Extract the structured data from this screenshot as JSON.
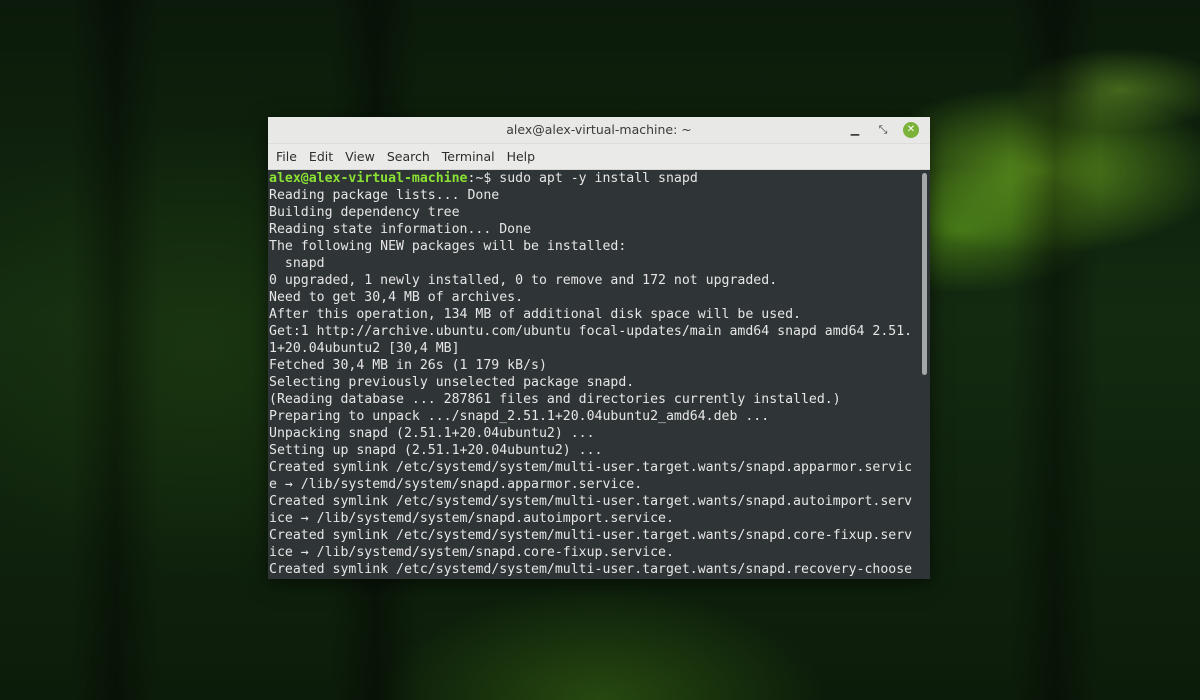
{
  "window": {
    "title": "alex@alex-virtual-machine: ~",
    "controls": {
      "minimize": "minimize-icon",
      "maximize": "restore-icon",
      "close": "close-icon"
    }
  },
  "menu": {
    "items": [
      "File",
      "Edit",
      "View",
      "Search",
      "Terminal",
      "Help"
    ]
  },
  "terminal": {
    "prompt_user": "alex@alex-virtual-machine",
    "prompt_sep": ":~$ ",
    "command": "sudo apt -y install snapd",
    "output": [
      "Reading package lists... Done",
      "Building dependency tree",
      "Reading state information... Done",
      "The following NEW packages will be installed:",
      "  snapd",
      "0 upgraded, 1 newly installed, 0 to remove and 172 not upgraded.",
      "Need to get 30,4 MB of archives.",
      "After this operation, 134 MB of additional disk space will be used.",
      "Get:1 http://archive.ubuntu.com/ubuntu focal-updates/main amd64 snapd amd64 2.51.",
      "1+20.04ubuntu2 [30,4 MB]",
      "Fetched 30,4 MB in 26s (1 179 kB/s)",
      "Selecting previously unselected package snapd.",
      "(Reading database ... 287861 files and directories currently installed.)",
      "Preparing to unpack .../snapd_2.51.1+20.04ubuntu2_amd64.deb ...",
      "Unpacking snapd (2.51.1+20.04ubuntu2) ...",
      "Setting up snapd (2.51.1+20.04ubuntu2) ...",
      "Created symlink /etc/systemd/system/multi-user.target.wants/snapd.apparmor.servic",
      "e → /lib/systemd/system/snapd.apparmor.service.",
      "Created symlink /etc/systemd/system/multi-user.target.wants/snapd.autoimport.serv",
      "ice → /lib/systemd/system/snapd.autoimport.service.",
      "Created symlink /etc/systemd/system/multi-user.target.wants/snapd.core-fixup.serv",
      "ice → /lib/systemd/system/snapd.core-fixup.service.",
      "Created symlink /etc/systemd/system/multi-user.target.wants/snapd.recovery-choose"
    ]
  },
  "colors": {
    "prompt_user": "#8ae234",
    "terminal_bg": "#2f3436",
    "terminal_fg": "#e6e6e6",
    "close_button": "#7bb23a"
  }
}
